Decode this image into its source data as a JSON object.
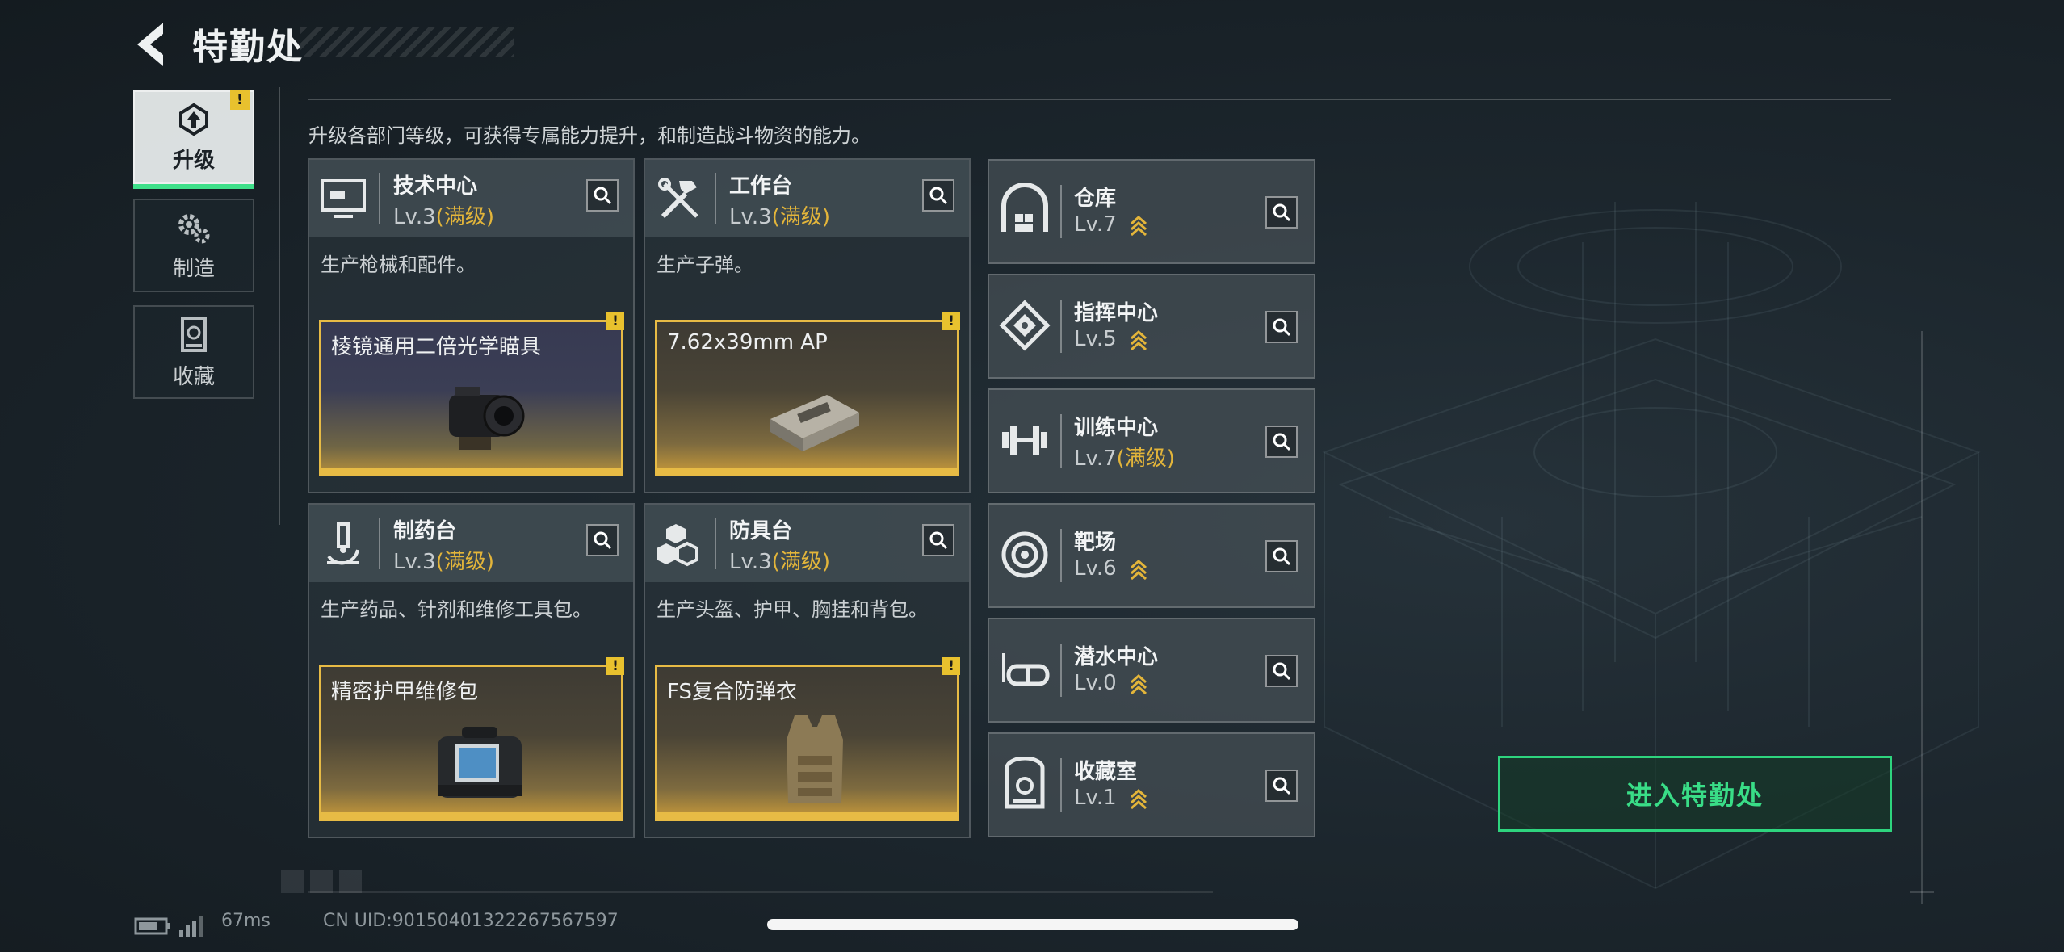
{
  "header": {
    "title": "特勤处"
  },
  "tabs": [
    {
      "label": "升级",
      "icon": "upgrade-icon",
      "active": true,
      "alert": "!"
    },
    {
      "label": "制造",
      "icon": "gears-icon",
      "active": false
    },
    {
      "label": "收藏",
      "icon": "collection-icon",
      "active": false
    }
  ],
  "subtitle": "升级各部门等级，可获得专属能力提升，和制造战斗物资的能力。",
  "facility_cards": [
    {
      "name": "技术中心",
      "level": "Lv.3",
      "max_label": "(满级)",
      "icon": "monitor-icon",
      "desc": "生产枪械和配件。",
      "product": {
        "name": "棱镜通用二倍光学瞄具",
        "alert": "!",
        "tone": "purple",
        "art": "scope-art"
      }
    },
    {
      "name": "工作台",
      "level": "Lv.3",
      "max_label": "(满级)",
      "icon": "tools-icon",
      "desc": "生产子弹。",
      "product": {
        "name": "7.62x39mm AP",
        "alert": "!",
        "tone": "gold",
        "art": "ammo-box-art"
      }
    },
    {
      "name": "制药台",
      "level": "Lv.3",
      "max_label": "(满级)",
      "icon": "microscope-icon",
      "desc": "生产药品、针剂和维修工具包。",
      "product": {
        "name": "精密护甲维修包",
        "alert": "!",
        "tone": "gold",
        "art": "repair-kit-art"
      }
    },
    {
      "name": "防具台",
      "level": "Lv.3",
      "max_label": "(满级)",
      "icon": "armor-blocks-icon",
      "desc": "生产头盔、护甲、胸挂和背包。",
      "product": {
        "name": "FS复合防弹衣",
        "alert": "!",
        "tone": "gold",
        "art": "vest-art"
      }
    }
  ],
  "facility_rows": [
    {
      "name": "仓库",
      "level": "Lv.7",
      "max_label": "",
      "upgradable": true,
      "icon": "warehouse-icon"
    },
    {
      "name": "指挥中心",
      "level": "Lv.5",
      "max_label": "",
      "upgradable": true,
      "icon": "command-chip-icon"
    },
    {
      "name": "训练中心",
      "level": "Lv.7",
      "max_label": "(满级)",
      "upgradable": false,
      "icon": "dumbbell-icon"
    },
    {
      "name": "靶场",
      "level": "Lv.6",
      "max_label": "",
      "upgradable": true,
      "icon": "target-icon"
    },
    {
      "name": "潜水中心",
      "level": "Lv.0",
      "max_label": "",
      "upgradable": true,
      "icon": "diving-mask-icon"
    },
    {
      "name": "收藏室",
      "level": "Lv.1",
      "max_label": "",
      "upgradable": true,
      "icon": "collection-room-icon"
    }
  ],
  "enter_button": "进入特勤处",
  "status": {
    "ping": "67ms",
    "uid": "CN UID:9015040132226756​7597"
  },
  "colors": {
    "accent_green": "#2ed47e",
    "max_level_gold": "#e3b53a",
    "alert_yellow": "#e8c12e"
  }
}
